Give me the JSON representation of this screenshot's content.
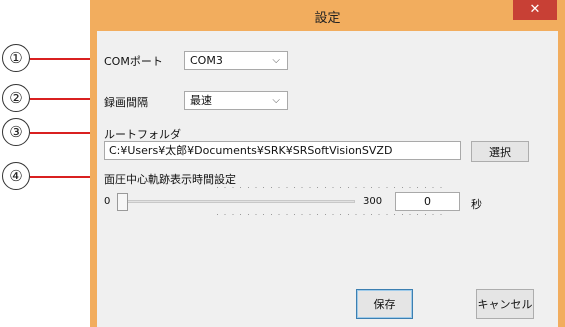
{
  "callouts": [
    "①",
    "②",
    "③",
    "④"
  ],
  "dialog": {
    "title": "設定",
    "close_glyph": "✕",
    "com_port": {
      "label": "COMポート",
      "value": "COM3",
      "arrow": "⌵"
    },
    "rec_interval": {
      "label": "録画間隔",
      "value": "最速",
      "arrow": "⌵"
    },
    "root_folder": {
      "label": "ルートフォルダ",
      "path": "C:¥Users¥太郎¥Documents¥SRK¥SRSoftVisionSVZD",
      "select_label": "選択"
    },
    "pressure_display": {
      "label": "面圧中心軌跡表示時間設定",
      "min_label": "0",
      "max_label": "300",
      "slider_value": 0,
      "input_value": "0",
      "unit": "秒"
    },
    "save_label": "保存",
    "cancel_label": "キャンセル"
  },
  "colors": {
    "frame_orange": "#f2ad5e",
    "close_red": "#c84035",
    "callout_red": "#d92020"
  }
}
